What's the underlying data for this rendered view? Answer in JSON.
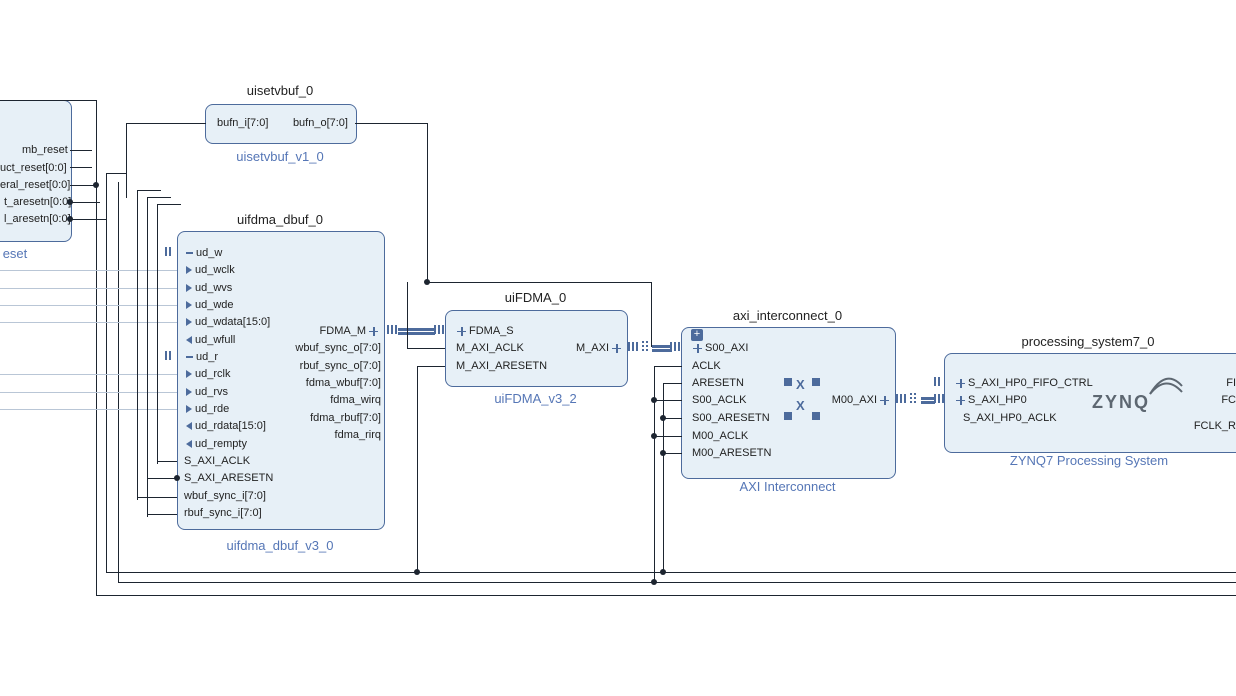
{
  "blocks": {
    "reset_stub": {
      "ports": [
        "mb_reset",
        "uct_reset[0:0]",
        "eral_reset[0:0]",
        "t_aresetn[0:0]",
        "l_aresetn[0:0]"
      ],
      "subtitle": "eset"
    },
    "uisetvbuf": {
      "title": "uisetvbuf_0",
      "left_port": "bufn_i[7:0]",
      "right_port": "bufn_o[7:0]",
      "subtitle": "uisetvbuf_v1_0"
    },
    "uifdma_dbuf": {
      "title": "uifdma_dbuf_0",
      "left_ports": [
        {
          "t": "ud_w",
          "k": "dash"
        },
        {
          "t": "ud_wclk",
          "k": "tri"
        },
        {
          "t": "ud_wvs",
          "k": "tri"
        },
        {
          "t": "ud_wde",
          "k": "tri"
        },
        {
          "t": "ud_wdata[15:0]",
          "k": "tri"
        },
        {
          "t": "ud_wfull",
          "k": "tri-l"
        },
        {
          "t": "ud_r",
          "k": "dash"
        },
        {
          "t": "ud_rclk",
          "k": "tri"
        },
        {
          "t": "ud_rvs",
          "k": "tri"
        },
        {
          "t": "ud_rde",
          "k": "tri"
        },
        {
          "t": "ud_rdata[15:0]",
          "k": "tri-l"
        },
        {
          "t": "ud_rempty",
          "k": "tri-l"
        },
        {
          "t": "S_AXI_ACLK",
          "k": "none"
        },
        {
          "t": "S_AXI_ARESETN",
          "k": "none"
        },
        {
          "t": "wbuf_sync_i[7:0]",
          "k": "none"
        },
        {
          "t": "rbuf_sync_i[7:0]",
          "k": "none"
        }
      ],
      "right_ports": [
        "FDMA_M",
        "wbuf_sync_o[7:0]",
        "rbuf_sync_o[7:0]",
        "fdma_wbuf[7:0]",
        "fdma_wirq",
        "fdma_rbuf[7:0]",
        "fdma_rirq"
      ],
      "subtitle": "uifdma_dbuf_v3_0"
    },
    "uiFDMA": {
      "title": "uiFDMA_0",
      "left_ports": [
        "FDMA_S",
        "M_AXI_ACLK",
        "M_AXI_ARESETN"
      ],
      "right_port": "M_AXI",
      "subtitle": "uiFDMA_v3_2"
    },
    "axi_interconnect": {
      "title": "axi_interconnect_0",
      "left_ports": [
        "S00_AXI",
        "ACLK",
        "ARESETN",
        "S00_ACLK",
        "S00_ARESETN",
        "M00_ACLK",
        "M00_ARESETN"
      ],
      "right_port": "M00_AXI",
      "subtitle": "AXI Interconnect"
    },
    "ps7": {
      "title": "processing_system7_0",
      "left_ports": [
        "S_AXI_HP0_FIFO_CTRL",
        "S_AXI_HP0",
        "S_AXI_HP0_ACLK"
      ],
      "right_ports": [
        "FI",
        "FC",
        "FCLK_R"
      ],
      "subtitle": "ZYNQ7 Processing System",
      "logo": "ZYNQ"
    }
  }
}
